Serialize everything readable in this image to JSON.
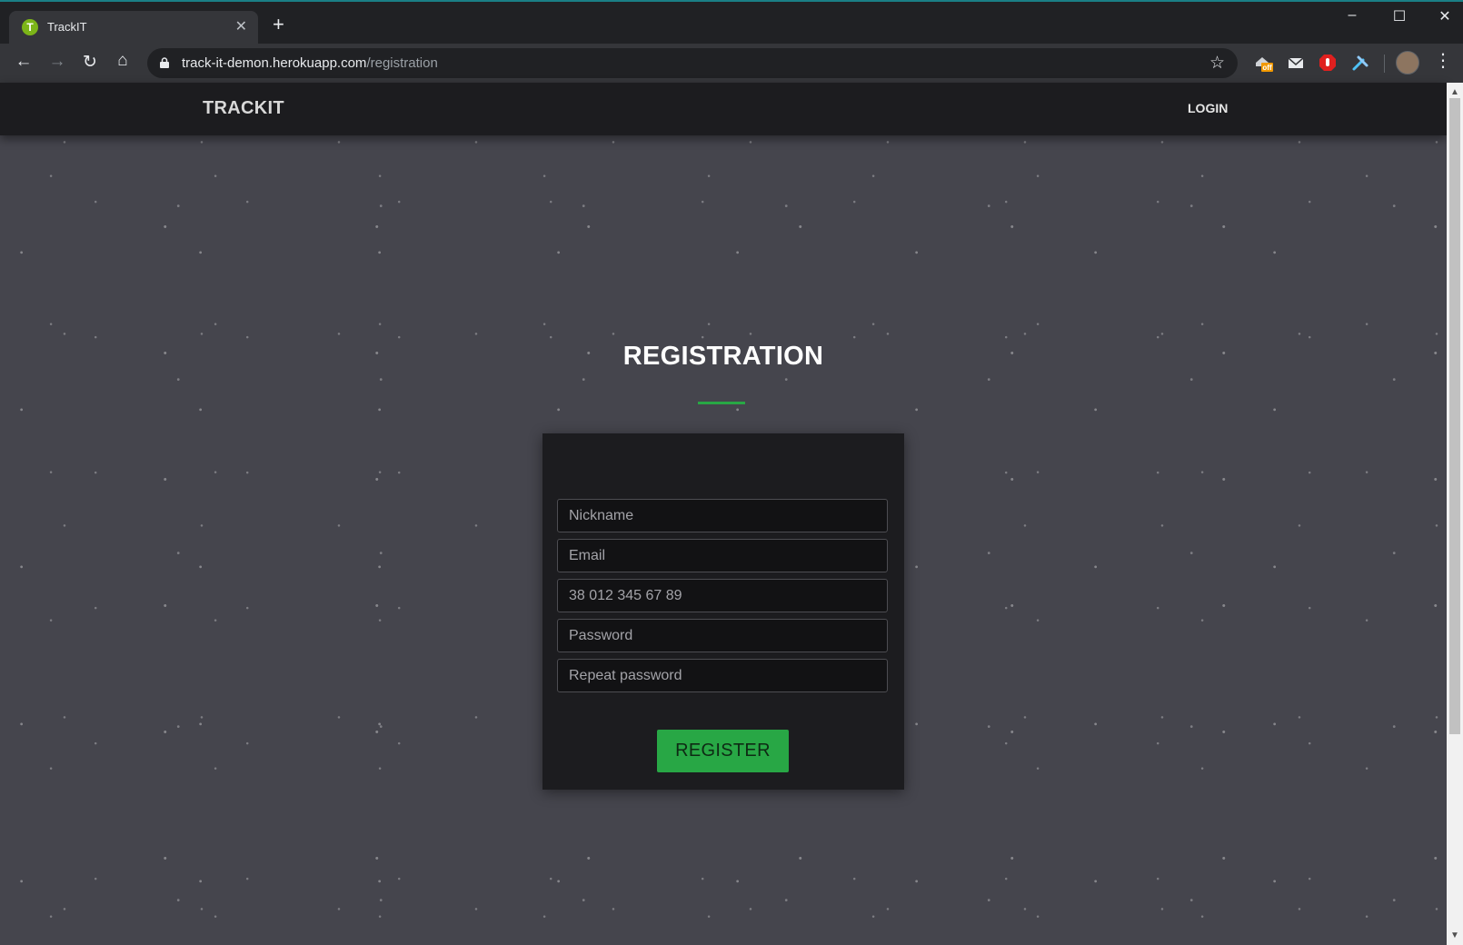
{
  "browser": {
    "tab_title": "TrackIT",
    "tab_favicon_letter": "T",
    "url_host": "track-it-demon.herokuapp.com",
    "url_path": "/registration",
    "extension_badge": "off"
  },
  "header": {
    "brand": "TRACKIT",
    "login_label": "LOGIN"
  },
  "registration": {
    "title": "REGISTRATION",
    "fields": {
      "nickname_placeholder": "Nickname",
      "email_placeholder": "Email",
      "phone_placeholder": "38 012 345 67 89",
      "password_placeholder": "Password",
      "repeat_password_placeholder": "Repeat password"
    },
    "submit_label": "REGISTER"
  },
  "colors": {
    "accent": "#28a745",
    "header_bg": "#1c1c1f",
    "page_bg": "#45454d"
  }
}
